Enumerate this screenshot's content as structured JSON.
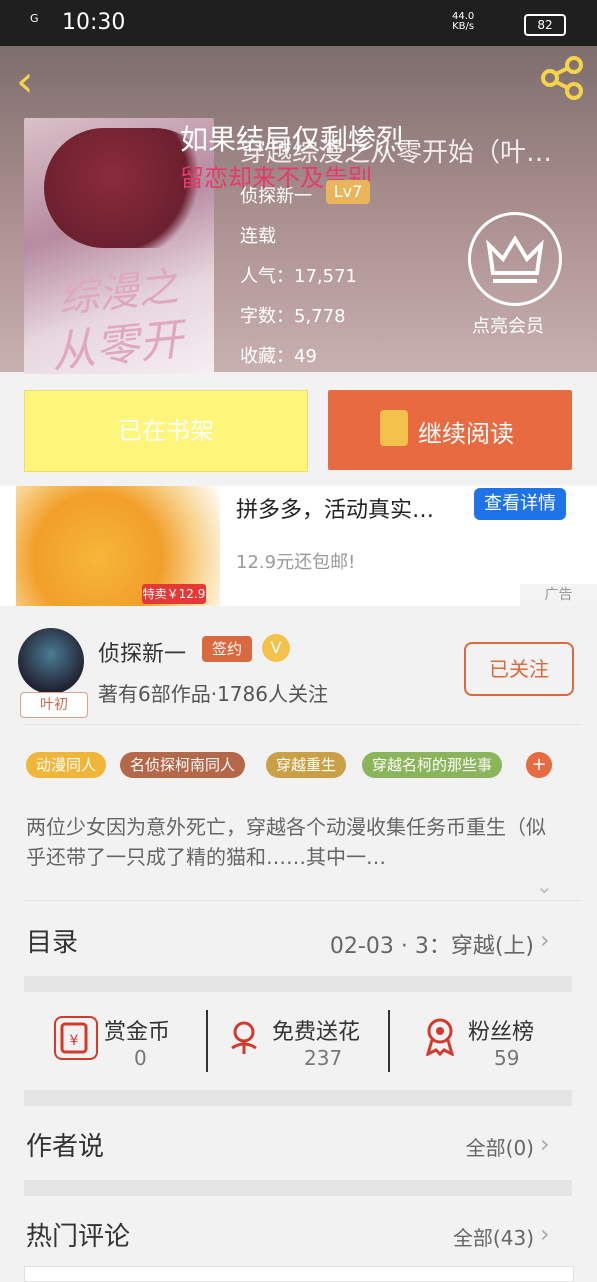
{
  "status": {
    "time": "10:30",
    "signal": "G",
    "net_speed": "44.0",
    "net_unit": "KB/s",
    "battery": "82"
  },
  "book": {
    "overlay_line1": "如果结局仅剩惨烈",
    "title": "穿越综漫之从零开始（叶…",
    "overlay_line2": "留恋却来不及告别",
    "author": "侦探新一",
    "level": "Lv7",
    "status": "连载",
    "popularity": "人气：17,571",
    "words": "字数：5,778",
    "favorites": "收藏：49",
    "vip_label": "点亮会员",
    "cover_text1": "综漫之",
    "cover_text2": "从零开始"
  },
  "actions": {
    "on_shelf": "已在书架",
    "continue": "继续阅读"
  },
  "ad": {
    "title": "拼多多，活动真实…",
    "detail": "查看详情",
    "price": "12.9元还包邮!",
    "badge": "特卖￥12.9",
    "label": "广告"
  },
  "author_card": {
    "name": "侦探新一",
    "sign": "签约",
    "stats": "著有6部作品·1786人关注",
    "follow": "已关注",
    "avatar_label": "叶初"
  },
  "tags": [
    {
      "label": "动漫同人",
      "color": "#f0b63a"
    },
    {
      "label": "名侦探柯南同人",
      "color": "#b5674a"
    },
    {
      "label": "穿越重生",
      "color": "#c9a045"
    },
    {
      "label": "穿越名柯的那些事",
      "color": "#8bb55a"
    }
  ],
  "tag_add": "+",
  "description": "两位少女因为意外死亡，穿越各个动漫收集任务币重生（似乎还带了一只成了精的猫和……其中一…",
  "catalog": {
    "title": "目录",
    "latest": "02-03 · 3：穿越(上)"
  },
  "stats": [
    {
      "label": "赏金币",
      "value": "0"
    },
    {
      "label": "免费送花",
      "value": "237"
    },
    {
      "label": "粉丝榜",
      "value": "59"
    }
  ],
  "author_says": {
    "title": "作者说",
    "right": "全部(0)"
  },
  "comments": {
    "title": "热门评论",
    "right": "全部(43)"
  }
}
